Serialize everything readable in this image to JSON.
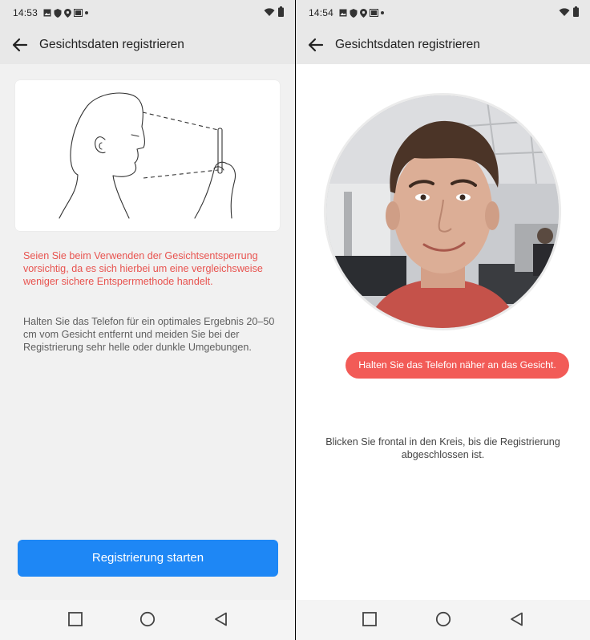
{
  "left": {
    "status_time": "14:53",
    "title": "Gesichtsdaten registrieren",
    "warning": "Seien Sie beim Verwenden der Gesichtsentsperrung vorsichtig, da es sich hierbei um eine vergleichsweise weniger sichere Entsperrmethode handelt.",
    "info": "Halten Sie das Telefon für ein optimales Ergebnis 20–50 cm vom Gesicht entfernt und meiden Sie bei der Registrierung sehr helle oder dunkle Umgebungen.",
    "button_label": "Registrierung starten"
  },
  "right": {
    "status_time": "14:54",
    "title": "Gesichtsdaten registrieren",
    "hint": "Halten Sie das Telefon näher an das Gesicht.",
    "instruction": "Blicken Sie frontal in den Kreis, bis die Registrierung abgeschlossen ist."
  },
  "colors": {
    "accent": "#1e87f5",
    "warning": "#e8534f",
    "hint_bg": "#f25b57"
  },
  "icons": {
    "back": "arrow-left-icon",
    "wifi": "wifi-icon",
    "battery": "battery-icon",
    "nav_recent": "square-icon",
    "nav_home": "circle-icon",
    "nav_back": "triangle-back-icon"
  }
}
